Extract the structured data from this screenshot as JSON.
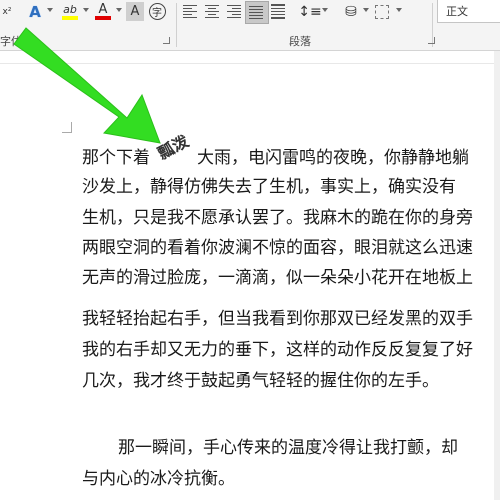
{
  "ribbon": {
    "font_group_label": "字体",
    "paragraph_group_label": "段落",
    "superscript_hint": "x²",
    "text_effect_label": "A",
    "highlight_label": "ab",
    "font_color_label": "A",
    "char_shading_label": "A",
    "enclose_char_label": "字",
    "style_label": "正文",
    "colors": {
      "highlight": "#ffff00",
      "font_color": "#e00000",
      "text_effect": "#2f6fbf"
    }
  },
  "document": {
    "lines": [
      "那个下着",
      "大雨，电闪雷鸣的夜晚，你静静地躺",
      "沙发上，静得仿佛失去了生机，事实上，确实没有",
      "生机，只是我不愿承认罢了。我麻木的跪在你的身旁",
      "两眼空洞的看着你波澜不惊的面容，眼泪就这么迅速",
      "无声的滑过脸庞，一滴滴，似一朵朵小花开在地板上",
      "我轻轻抬起右手，但当我看到你那双已经发黑的双手",
      "我的右手却又无力的垂下，这样的动作反反复复了好",
      "几次，我才终于鼓起勇气轻轻的握住你的左手。",
      "那一瞬间，手心传来的温度冷得让我打颤，却",
      "与内心的冰冷抗衡。"
    ],
    "rotated_text": "瓢泼"
  },
  "annotation": {
    "arrow_color": "#33dd22"
  }
}
